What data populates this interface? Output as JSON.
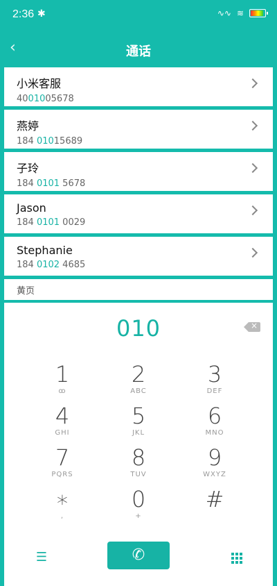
{
  "status": {
    "time": "2:36"
  },
  "header": {
    "title": "通话",
    "back_glyph": "‹"
  },
  "contacts": [
    {
      "name": "小米客服",
      "num_pre": "40",
      "num_hl": "010",
      "num_post": "05678"
    },
    {
      "name": "燕婷",
      "num_pre": "184 ",
      "num_hl": "010",
      "num_post": "15689"
    },
    {
      "name": "子玲",
      "num_pre": "184 ",
      "num_hl": "0101",
      "num_post": " 5678"
    },
    {
      "name": "Jason",
      "num_pre": "184 ",
      "num_hl": "0101",
      "num_post": " 0029"
    },
    {
      "name": "Stephanie",
      "num_pre": "184 ",
      "num_hl": "0102",
      "num_post": " 4685"
    }
  ],
  "section": {
    "yellow_pages": "黄页"
  },
  "dialpad": {
    "input_value": "010",
    "keys": [
      {
        "digit": "1",
        "letters": "ꝏ"
      },
      {
        "digit": "2",
        "letters": "ABC"
      },
      {
        "digit": "3",
        "letters": "DEF"
      },
      {
        "digit": "4",
        "letters": "GHI"
      },
      {
        "digit": "5",
        "letters": "JKL"
      },
      {
        "digit": "6",
        "letters": "MNO"
      },
      {
        "digit": "7",
        "letters": "PQRS"
      },
      {
        "digit": "8",
        "letters": "TUV"
      },
      {
        "digit": "9",
        "letters": "WXYZ"
      },
      {
        "digit": "∗",
        "letters": ","
      },
      {
        "digit": "0",
        "letters": "+"
      },
      {
        "digit": "#",
        "letters": ""
      }
    ]
  },
  "icons": {
    "menu": "menu-icon",
    "call": "phone-call-icon",
    "grid": "dialpad-grid-icon",
    "backspace": "backspace-icon"
  },
  "colors": {
    "accent": "#15bbac"
  }
}
